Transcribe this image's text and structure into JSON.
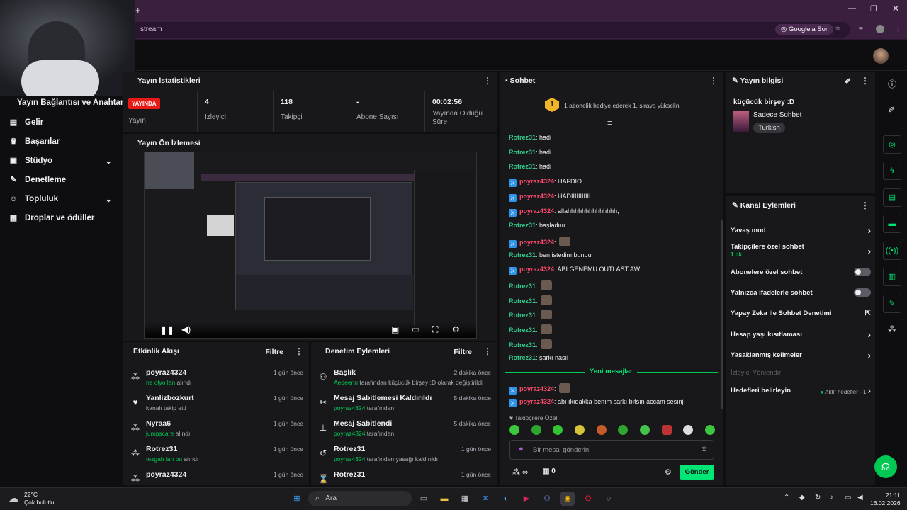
{
  "browser": {
    "new_tab_symbol": "+",
    "url": "stream",
    "google_btn": "Google'a Sor"
  },
  "webcam": {
    "caption": "Yayın Bağlantısı ve Anahtarı"
  },
  "sidebar": {
    "items": [
      {
        "label": "Gelir",
        "icon": "dollar-icon"
      },
      {
        "label": "Başarılar",
        "icon": "trophy-icon"
      },
      {
        "label": "Stüdyo",
        "icon": "studio-icon",
        "chevron": true
      },
      {
        "label": "Denetleme",
        "icon": "wrench-icon"
      },
      {
        "label": "Topluluk",
        "icon": "community-icon",
        "chevron": true
      },
      {
        "label": "Droplar ve ödüller",
        "icon": "gift-icon"
      }
    ]
  },
  "stats": {
    "title": "Yayın İstatistikleri",
    "live_badge": "YAYINDA",
    "live_label": "Yayın",
    "viewers": "4",
    "viewers_label": "İzleyici",
    "followers": "118",
    "followers_label": "Takipçi",
    "subs": "-",
    "subs_label": "Abone Sayısı",
    "uptime": "00:02:56",
    "uptime_label": "Yayında Olduğu Süre"
  },
  "preview": {
    "title": "Yayın Ön İzlemesi"
  },
  "activity": {
    "title": "Etkinlik Akışı",
    "filter": "Filtre",
    "items": [
      {
        "name": "poyraz4324",
        "highlight": "ne olyo lan",
        "suffix": "alındı",
        "time": "1 gün önce",
        "icon": "channel-points-icon"
      },
      {
        "name": "Yanlizbozkurt",
        "highlight": "",
        "suffix": "kanalı takip etti",
        "time": "1 gün önce",
        "icon": "heart-icon"
      },
      {
        "name": "Nyraa6",
        "highlight": "jumpscare",
        "suffix": "alındı",
        "time": "1 gün önce",
        "icon": "channel-points-icon"
      },
      {
        "name": "Rotrez31",
        "highlight": "tezgah lan bu",
        "suffix": "alındı",
        "time": "1 gün önce",
        "icon": "channel-points-icon"
      },
      {
        "name": "poyraz4324",
        "highlight": "",
        "suffix": "",
        "time": "1 gün önce",
        "icon": "channel-points-icon"
      }
    ]
  },
  "modactions": {
    "title": "Denetim Eylemleri",
    "filter": "Filtre",
    "items": [
      {
        "name": "Başlık",
        "user": "Aedeenn",
        "text": "tarafından küçücük birşey :D olarak değiştirildi",
        "time": "2 dakika önce",
        "icon": "title-icon"
      },
      {
        "name": "Mesaj Sabitlemesi Kaldırıldı",
        "user": "poyraz4324",
        "text": "tarafından",
        "time": "5 dakika önce",
        "icon": "unpin-icon"
      },
      {
        "name": "Mesaj Sabitlendi",
        "user": "poyraz4324",
        "text": "tarafından",
        "time": "5 dakika önce",
        "icon": "pin-icon"
      },
      {
        "name": "Rotrez31",
        "user": "poyraz4324",
        "text": "tarafından yasağı kaldırıldı",
        "time": "1 gün önce",
        "icon": "unban-icon"
      },
      {
        "name": "Rotrez31",
        "user": "",
        "text": "",
        "time": "1 gün önce",
        "icon": "timeout-icon"
      }
    ]
  },
  "chat": {
    "title": "Sohbet",
    "gift_banner": "1 abonelik hediye ederek 1. sıraya yükselin",
    "gift_rank": "1",
    "messages": [
      {
        "user": "Rotrez31",
        "type": "r",
        "text": "hadi"
      },
      {
        "user": "Rotrez31",
        "type": "r",
        "text": "hadi"
      },
      {
        "user": "Rotrez31",
        "type": "r",
        "text": "hadi"
      },
      {
        "user": "poyraz4324",
        "type": "p",
        "text": "HAFDIO"
      },
      {
        "user": "poyraz4324",
        "type": "p",
        "text": "HADIIIIIIIIIII"
      },
      {
        "user": "poyraz4324",
        "type": "p",
        "text": "allahhhhhhhhhhhhhh,"
      },
      {
        "user": "Rotrez31",
        "type": "r",
        "text": "başladıııı"
      },
      {
        "user": "poyraz4324",
        "type": "p",
        "text": "",
        "emote": true
      },
      {
        "user": "Rotrez31",
        "type": "r",
        "text": "ben istedim bunuu"
      },
      {
        "user": "poyraz4324",
        "type": "p",
        "text": "ABI GENEMU OUTLAST AW"
      },
      {
        "user": "Rotrez31",
        "type": "r",
        "text": "",
        "emote": true
      },
      {
        "user": "Rotrez31",
        "type": "r",
        "text": "",
        "emote": true
      },
      {
        "user": "Rotrez31",
        "type": "r",
        "text": "",
        "emote": true
      },
      {
        "user": "Rotrez31",
        "type": "r",
        "text": "",
        "emote": true
      },
      {
        "user": "Rotrez31",
        "type": "r",
        "text": "",
        "emote": true
      },
      {
        "user": "Rotrez31",
        "type": "r",
        "text": "şarkı nasıl"
      }
    ],
    "new_messages": "Yeni mesajlar",
    "new": [
      {
        "user": "poyraz4324",
        "type": "p",
        "text": "",
        "emote": true
      },
      {
        "user": "poyraz4324",
        "type": "p",
        "text": "abı ıkıdakka benım sarkı bıtsın accam sesınj"
      }
    ],
    "followers_only": "Takipçilere Özel",
    "placeholder": "Bir mesaj gönderin",
    "points": "∞",
    "gifts": "0",
    "send": "Gönder"
  },
  "streaminfo": {
    "title": "Yayın bilgisi",
    "stream_title": "küçücük birşey :D",
    "category": "Sadece Sohbet",
    "language": "Turkish"
  },
  "channel_actions": {
    "title": "Kanal Eylemleri",
    "items": [
      {
        "label": "Yavaş mod",
        "kind": "chevron"
      },
      {
        "label": "Takipçilere özel sohbet",
        "sub": "1 dk.",
        "kind": "chevron"
      },
      {
        "label": "Abonelere özel sohbet",
        "kind": "toggle"
      },
      {
        "label": "Yalnızca ifadelerle sohbet",
        "kind": "toggle"
      },
      {
        "label": "Yapay Zeka ile Sohbet Denetimi",
        "kind": "external"
      },
      {
        "label": "Hesap yaşı kısıtlaması",
        "kind": "chevron"
      },
      {
        "label": "Yasaklanmış kelimeler",
        "kind": "chevron"
      }
    ],
    "disabled": "İzleyici Yönlendir",
    "goals": "Hedefleri belirleyin",
    "goals_status": "Aktif hedefler - 1"
  },
  "taskbar": {
    "temp": "22°C",
    "weather": "Çok bulutlu",
    "search": "Ara",
    "time": "21:11",
    "date": "16.02.2026"
  },
  "colors": {
    "accent": "#00e676",
    "live": "#e91916",
    "panel": "#18181b"
  }
}
